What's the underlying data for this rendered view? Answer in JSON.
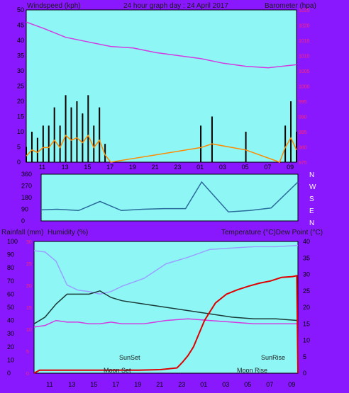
{
  "top_header": {
    "left": "Windspeed (kph)",
    "center": "24 hour graph day : 24 April 2017",
    "right": "Barometer (hpa)"
  },
  "mid_header": {
    "left1": "Rainfall (mm)",
    "left2": "Humidity (%)",
    "right": "Temperature (°C)Dew Point (°C)"
  },
  "direction_labels": [
    "N",
    "W",
    "S",
    "E",
    "N"
  ],
  "x_tick_labels": [
    "11",
    "13",
    "15",
    "17",
    "19",
    "21",
    "23",
    "01",
    "03",
    "05",
    "07",
    "09"
  ],
  "annotations": [
    "SunSet",
    "SunRise",
    "Moon Set",
    "Moon Rise"
  ],
  "colors": {
    "plot_bg": "#8ef7f5",
    "frame": "#8a18ff",
    "wind_gust": "#000000",
    "wind_avg": "#ff8a00",
    "wind_light": "#7cd48a",
    "barometer": "#d23ce0",
    "direction": "#2a6a9a",
    "humidity": "#9aa0ff",
    "temperature": "#1a3a38",
    "dewpoint": "#d23ce0",
    "rainfall": "#e00000",
    "right_axis": "#ff2a6e"
  },
  "chart_data": [
    {
      "type": "line",
      "name": "wind-barometer",
      "x_unit": "hour",
      "xlim": [
        9.5,
        9.5
      ],
      "y_left_label": "Windspeed (kph)",
      "y_left_ticks": [
        0,
        5,
        10,
        15,
        20,
        25,
        30,
        35,
        40,
        45,
        50
      ],
      "ylim_left": [
        0,
        50
      ],
      "y_right_label": "Barometer (hpa)",
      "y_right_ticks": [
        975,
        980,
        985,
        990,
        995,
        1000,
        1005,
        1010,
        1015,
        1020,
        1025
      ],
      "ylim_right": [
        975,
        1025
      ],
      "series": [
        {
          "name": "Barometer (hpa)",
          "axis": "right",
          "x": [
            9.5,
            11,
            13,
            15,
            17,
            19,
            21,
            23,
            1,
            3,
            5,
            7,
            9.5
          ],
          "values": [
            1021,
            1019,
            1016,
            1014.5,
            1013,
            1012.5,
            1011,
            1010,
            1009,
            1007.5,
            1006.5,
            1006,
            1007
          ]
        },
        {
          "name": "Windspeed (kph)",
          "axis": "left",
          "x": [
            9.5,
            10,
            10.5,
            11,
            11.5,
            12,
            12.5,
            13,
            13.5,
            14,
            14.5,
            15,
            15.5,
            16,
            16.5,
            17,
            1,
            2,
            5,
            8,
            8.5,
            9,
            9.5
          ],
          "values": [
            5,
            10,
            8,
            12,
            12,
            18,
            12,
            22,
            18,
            20,
            16,
            22,
            12,
            18,
            6,
            0,
            12,
            15,
            10,
            0,
            12,
            20,
            10
          ]
        }
      ]
    },
    {
      "type": "line",
      "name": "wind-direction",
      "x_unit": "hour",
      "y_ticks": [
        0,
        90,
        180,
        270,
        360
      ],
      "ylim": [
        0,
        360
      ],
      "series": [
        {
          "name": "Direction",
          "x": [
            9.5,
            11,
            13,
            15,
            17,
            19,
            21,
            23,
            0.5,
            3,
            5,
            7,
            9.5
          ],
          "values": [
            85,
            90,
            80,
            150,
            80,
            90,
            95,
            95,
            300,
            70,
            80,
            100,
            300
          ]
        }
      ]
    },
    {
      "type": "line",
      "name": "humidity-temperature-rain",
      "x_unit": "hour",
      "y_left_label": "Humidity (%)",
      "y_left_ticks": [
        0,
        10,
        20,
        30,
        40,
        50,
        60,
        70,
        80,
        90,
        100
      ],
      "ylim_left": [
        0,
        100
      ],
      "y_left2_label": "Rainfall (mm)",
      "y_left2_ticks": [
        0,
        5,
        10,
        15,
        20,
        25,
        30
      ],
      "ylim_left2": [
        0,
        30
      ],
      "y_right_label": "Temperature (°C)Dew Point (°C)",
      "y_right_ticks": [
        0,
        5,
        10,
        15,
        20,
        25,
        30,
        35,
        40
      ],
      "ylim_right": [
        0,
        40
      ],
      "series": [
        {
          "name": "Humidity (%)",
          "axis": "left",
          "x": [
            9.5,
            10.5,
            11.5,
            12.5,
            13.5,
            14.5,
            15.5,
            16.5,
            17.5,
            19.5,
            21.5,
            23.5,
            1.5,
            3.5,
            5.5,
            7.5,
            9.5
          ],
          "values": [
            93,
            92,
            85,
            67,
            63,
            62,
            60,
            62,
            66,
            72,
            83,
            88,
            94,
            95,
            96,
            96,
            97
          ]
        },
        {
          "name": "Temperature (°C)",
          "axis": "right",
          "x": [
            9.5,
            10.5,
            11.5,
            12.5,
            13.5,
            14.5,
            15.5,
            16.5,
            17.5,
            19.5,
            21.5,
            23.5,
            1.5,
            3.5,
            5.5,
            7.5,
            9.5
          ],
          "values": [
            15,
            17,
            21,
            24,
            24,
            24,
            25,
            23,
            22,
            21,
            20,
            19,
            18,
            17,
            16.5,
            16.5,
            16
          ]
        },
        {
          "name": "Dew Point (°C)",
          "axis": "right",
          "x": [
            9.5,
            10.5,
            11.5,
            12.5,
            13.5,
            14.5,
            15.5,
            16.5,
            17.5,
            19.5,
            21.5,
            23.5,
            1.5,
            3.5,
            5.5,
            7.5,
            9.5
          ],
          "values": [
            14,
            14.5,
            16,
            15.5,
            15.5,
            15,
            15,
            15.5,
            15,
            15,
            16,
            16.5,
            16,
            15.5,
            15,
            15,
            15
          ]
        },
        {
          "name": "Rainfall (mm)",
          "axis": "left2",
          "x": [
            9.5,
            10,
            17,
            19,
            21,
            22.5,
            23,
            23.5,
            0,
            0.5,
            1,
            1.5,
            2,
            3,
            4,
            5,
            6,
            7,
            8,
            9,
            9.4,
            9.5
          ],
          "values": [
            0,
            0.7,
            0.7,
            0.7,
            0.8,
            1.2,
            2.5,
            4,
            6,
            9,
            12,
            14,
            16,
            18,
            19,
            19.8,
            20.5,
            21,
            21.8,
            22,
            22.2,
            0
          ]
        }
      ]
    }
  ]
}
